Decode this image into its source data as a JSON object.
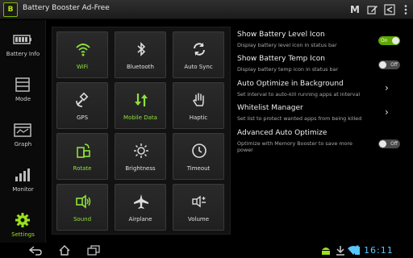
{
  "app": {
    "title": "Battery Booster Ad-Free",
    "logo_text": "B"
  },
  "actionbar": {
    "icons": [
      "mode-m-icon",
      "edit-icon",
      "settings-icon",
      "overflow-menu-icon"
    ],
    "m_label": "M"
  },
  "nav": {
    "items": [
      {
        "label": "Battery Info",
        "icon": "battery-icon"
      },
      {
        "label": "Mode",
        "icon": "mode-icon"
      },
      {
        "label": "Graph",
        "icon": "calendar-graph-icon"
      },
      {
        "label": "Monitor",
        "icon": "bar-chart-icon"
      },
      {
        "label": "Settings",
        "icon": "gear-icon",
        "active": true
      }
    ]
  },
  "tiles": [
    {
      "label": "WiFi",
      "icon": "wifi-icon",
      "on": true
    },
    {
      "label": "Bluetooth",
      "icon": "bluetooth-icon",
      "on": false
    },
    {
      "label": "Auto Sync",
      "icon": "sync-icon",
      "on": false
    },
    {
      "label": "GPS",
      "icon": "satellite-icon",
      "on": false
    },
    {
      "label": "Mobile Data",
      "icon": "data-arrows-icon",
      "on": true
    },
    {
      "label": "Haptic",
      "icon": "hand-icon",
      "on": false
    },
    {
      "label": "Rotate",
      "icon": "rotate-icon",
      "on": true
    },
    {
      "label": "Brightness",
      "icon": "sun-icon",
      "on": false
    },
    {
      "label": "Timeout",
      "icon": "clock-icon",
      "on": false
    },
    {
      "label": "Sound",
      "icon": "speaker-icon",
      "on": true
    },
    {
      "label": "Airplane",
      "icon": "airplane-icon",
      "on": false
    },
    {
      "label": "Volume",
      "icon": "volume-icon",
      "on": false
    }
  ],
  "settings": [
    {
      "title": "Show Battery Level Icon",
      "subtitle": "Display battery level icon in status bar",
      "control": "toggle",
      "state": "On"
    },
    {
      "title": "Show Battery Temp Icon",
      "subtitle": "Display battery temp icon in status bar",
      "control": "toggle",
      "state": "Off"
    },
    {
      "title": "Auto Optimize in Background",
      "subtitle": "Set interval to auto-kill running apps at interval",
      "control": "chevron",
      "chevron": "›"
    },
    {
      "title": "Whitelist Manager",
      "subtitle": "Set list to protect wanted apps from being killed",
      "control": "chevron",
      "chevron": "›"
    },
    {
      "title": "Advanced Auto Optimize",
      "subtitle": "Optimize with Memory Booster to save more power",
      "control": "toggle",
      "state": "Off"
    }
  ],
  "systembar": {
    "time": "16:11",
    "icons": [
      "back-icon",
      "home-icon",
      "recent-apps-icon",
      "android-icon",
      "download-icon",
      "wifi-icon",
      "battery-icon"
    ]
  },
  "colors": {
    "accent_green": "#8ee23a",
    "toggle_on": "#5fa800",
    "clock_blue": "#59c6ff"
  }
}
